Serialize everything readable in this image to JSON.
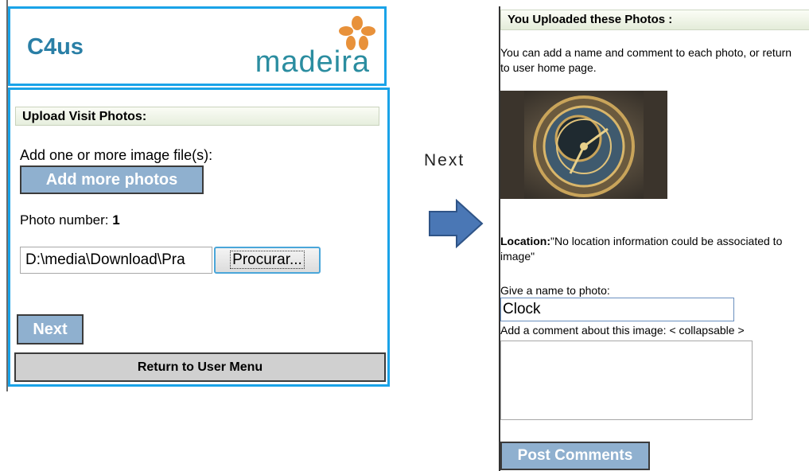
{
  "left_screen": {
    "app_title": "C4us",
    "logo_text": "madeira",
    "section_title": "Upload Visit Photos:",
    "add_label": "Add one or more image file(s):",
    "add_button": "Add more photos",
    "photo_number_label": "Photo number:",
    "photo_number_value": "1",
    "file_value": "D:\\media\\Download\\Pra",
    "browse_button": "Procurar...",
    "next_button": "Next",
    "return_button": "Return to User Menu"
  },
  "transition": {
    "caption": "Next"
  },
  "right_screen": {
    "section_title": "You Uploaded these Photos :",
    "intro_text": "You can add a name and comment to each photo, or return to user home page.",
    "location_label": "Location:",
    "location_text": "\"No location information could be associated to image\"",
    "name_label": "Give a name to photo:",
    "name_value": "Clock",
    "comment_label": "Add a comment about this image: < collapsable >",
    "post_button": "Post Comments"
  },
  "colors": {
    "frame_border": "#1aa3e8",
    "button_fill": "#8fb0cf",
    "title_color": "#2a7fa6",
    "arrow_fill": "#4a77b5"
  }
}
